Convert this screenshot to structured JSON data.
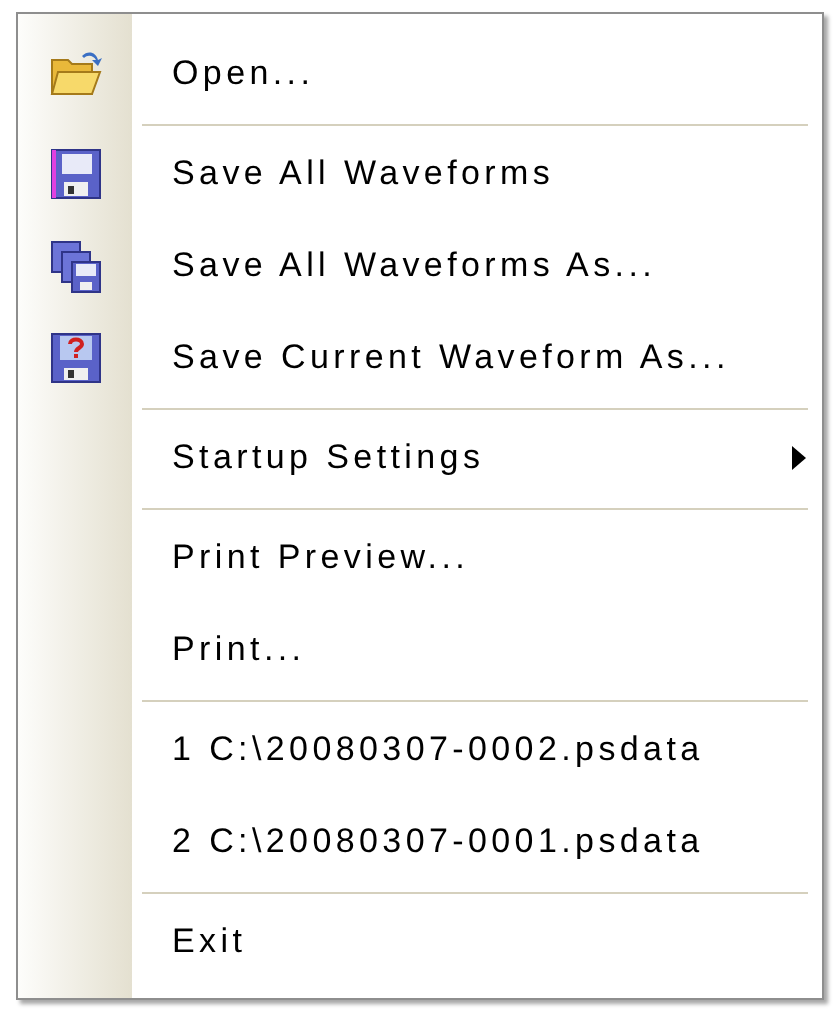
{
  "menu": {
    "items": [
      {
        "kind": "item",
        "label": "Open..."
      },
      {
        "kind": "separator"
      },
      {
        "kind": "item",
        "label": "Save All Waveforms"
      },
      {
        "kind": "item",
        "label": "Save All Waveforms As..."
      },
      {
        "kind": "item",
        "label": "Save Current Waveform As..."
      },
      {
        "kind": "separator"
      },
      {
        "kind": "item",
        "label": "Startup Settings",
        "submenu": true
      },
      {
        "kind": "separator"
      },
      {
        "kind": "item",
        "label": "Print Preview..."
      },
      {
        "kind": "item",
        "label": "Print..."
      },
      {
        "kind": "separator"
      },
      {
        "kind": "item",
        "label": "1 C:\\20080307-0002.psdata"
      },
      {
        "kind": "item",
        "label": "2 C:\\20080307-0001.psdata"
      },
      {
        "kind": "separator"
      },
      {
        "kind": "item",
        "label": "Exit"
      }
    ]
  }
}
